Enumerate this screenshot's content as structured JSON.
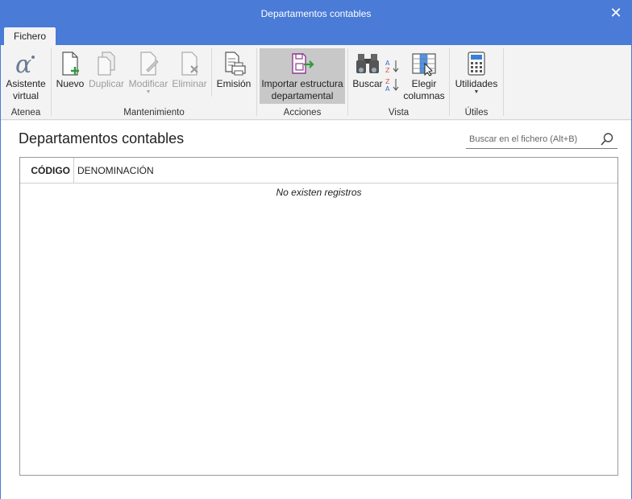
{
  "window": {
    "title": "Departamentos contables"
  },
  "tabs": [
    {
      "label": "Fichero"
    }
  ],
  "ribbon": {
    "groups": {
      "atenea": {
        "label": "Atenea",
        "buttons": {
          "asistente": "Asistente\nvirtual"
        }
      },
      "mantenimiento": {
        "label": "Mantenimiento",
        "buttons": {
          "nuevo": "Nuevo",
          "duplicar": "Duplicar",
          "modificar": "Modificar",
          "eliminar": "Eliminar",
          "emision": "Emisión"
        }
      },
      "acciones": {
        "label": "Acciones",
        "buttons": {
          "importar": "Importar estructura\ndepartamental"
        }
      },
      "vista": {
        "label": "Vista",
        "buttons": {
          "buscar": "Buscar",
          "elegir": "Elegir\ncolumnas"
        }
      },
      "utiles": {
        "label": "Útiles",
        "buttons": {
          "utilidades": "Utilidades"
        }
      }
    }
  },
  "main": {
    "page_title": "Departamentos contables",
    "search": {
      "placeholder": "Buscar en el fichero (Alt+B)"
    },
    "table": {
      "columns": [
        "CÓDIGO",
        "DENOMINACIÓN"
      ],
      "empty_text": "No existen registros"
    }
  },
  "colors": {
    "titlebar": "#4a7bd6",
    "accent_green": "#2e9b3a",
    "accent_purple": "#8b3a8f"
  }
}
